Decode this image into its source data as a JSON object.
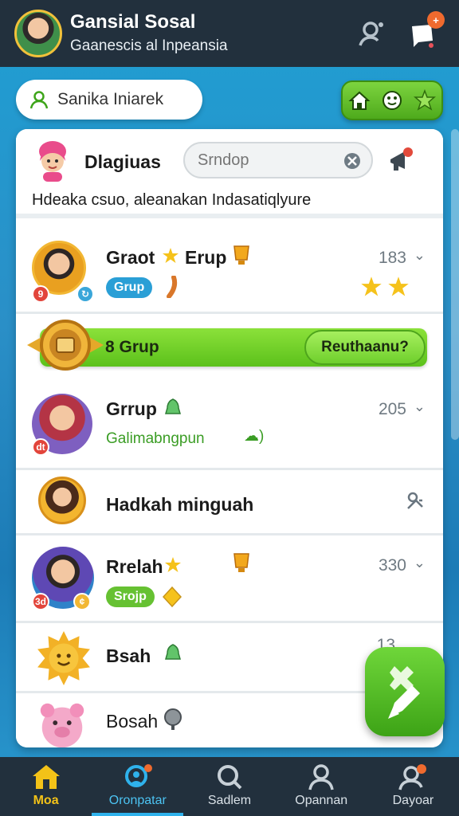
{
  "header": {
    "title": "Gansial Sosal",
    "subtitle": "Gaanescis al Inpeansia",
    "message_badge": "+"
  },
  "search_pill": {
    "label": "Sanika Iniarek"
  },
  "panel": {
    "name": "Dlagiuas",
    "search_placeholder": "Srndop",
    "description": "Hdeaka csuo, aleanakan Indasatiqlyure"
  },
  "rows": [
    {
      "name": "Graot",
      "name2": "Erup",
      "tag": "Grup",
      "count": "183",
      "badge": "9"
    },
    {
      "name": "Grrup",
      "subtitle": "Galimabngpun",
      "count": "205",
      "badge": "dt"
    },
    {
      "name": "Hadkah minguah"
    },
    {
      "name": "Rrelah",
      "tag": "Srojp",
      "count": "330",
      "badge": "3d"
    },
    {
      "name": "Bsah",
      "count": "13"
    },
    {
      "name": "Bosah"
    }
  ],
  "banner": {
    "label": "8 Grup",
    "action": "Reuthaanu?"
  },
  "nav": [
    {
      "label": "Moa"
    },
    {
      "label": "Oronpatar"
    },
    {
      "label": "Sadlem"
    },
    {
      "label": "Opannan"
    },
    {
      "label": "Dayoar"
    }
  ],
  "colors": {
    "header_bg": "#22303d",
    "accent_green": "#5cc11b",
    "accent_blue": "#2fb2ec",
    "badge_orange": "#ef6a2e"
  }
}
